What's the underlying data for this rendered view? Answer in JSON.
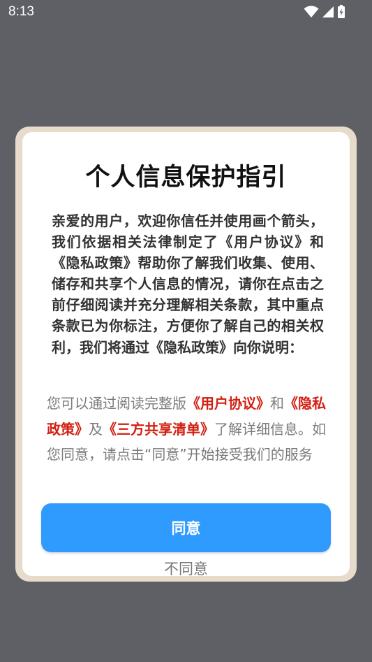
{
  "status_bar": {
    "time": "8:13",
    "icons": [
      "wifi-icon",
      "signal-icon",
      "battery-charging-icon"
    ]
  },
  "dialog": {
    "title": "个人信息保护指引",
    "intro": "亲爱的用户，欢迎你信任并使用画个箭头，我们依据相关法律制定了《用户协议》和《隐私政策》帮助你了解我们收集、使用、储存和共享个人信息的情况，请你在点击之前仔细阅读并充分理解相关条款，其中重点条款已为你标注，方便你了解自己的相关权利，我们将通过《隐私政策》向你说明：",
    "notice": {
      "part1": "您可以通过阅读完整版",
      "link_user_agreement": "《用户协议》",
      "part2": "和",
      "link_privacy_policy": "《隐私政策》",
      "part3": "及",
      "link_third_party": "《三方共享清单》",
      "part4": "了解详细信息。如您同意，请点击“同意”开始接受我们的服务"
    },
    "agree_label": "同意",
    "disagree_label": "不同意"
  },
  "colors": {
    "background": "#5f5f66",
    "frame": "#e7dccb",
    "accent": "#2f9bff",
    "link": "#d21f12"
  }
}
